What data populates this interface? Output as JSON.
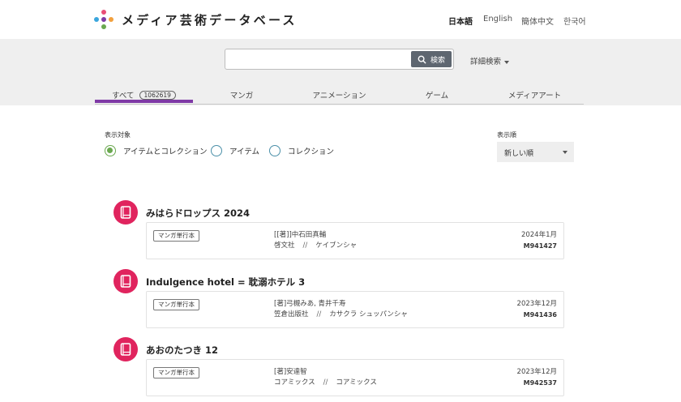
{
  "header": {
    "title": "メディア芸術データベース",
    "languages": [
      "日本語",
      "English",
      "簡体中文",
      "한국어"
    ]
  },
  "search": {
    "placeholder": "",
    "button_label": "検索",
    "advanced_label": "詳細検索"
  },
  "tabs": [
    {
      "label": "すべて",
      "count": "1062619",
      "active": true
    },
    {
      "label": "マンガ"
    },
    {
      "label": "アニメーション"
    },
    {
      "label": "ゲーム"
    },
    {
      "label": "メディアアート"
    }
  ],
  "filters": {
    "scope_label": "表示対象",
    "options": [
      "アイテムとコレクション",
      "アイテム",
      "コレクション"
    ],
    "selected": "アイテムとコレクション",
    "sort_label": "表示順",
    "sort_value": "新しい順"
  },
  "results": [
    {
      "title": "みはらドロップス 2024",
      "type": "マンガ単行本",
      "credit": "[[著]]中石田真輔",
      "publisher": "啓文社",
      "publisher_kana": "ケイブンシャ",
      "date": "2024年1月",
      "id": "M941427"
    },
    {
      "title": "Indulgence hotel = 耽溺ホテル 3",
      "type": "マンガ単行本",
      "credit": "[著]弓槻みあ, 青井千寿",
      "publisher": "笠倉出版社",
      "publisher_kana": "カサクラ シュッパンシャ",
      "date": "2023年12月",
      "id": "M941436"
    },
    {
      "title": "あおのたつき 12",
      "type": "マンガ単行本",
      "credit": "[著]安達智",
      "publisher": "コアミックス",
      "publisher_kana": "コアミックス",
      "date": "2023年12月",
      "id": "M942537"
    }
  ],
  "colors": {
    "accent_tab": "#7f3aa6",
    "book_icon": "#e0245e",
    "radio_selected": "#6aa84f"
  }
}
